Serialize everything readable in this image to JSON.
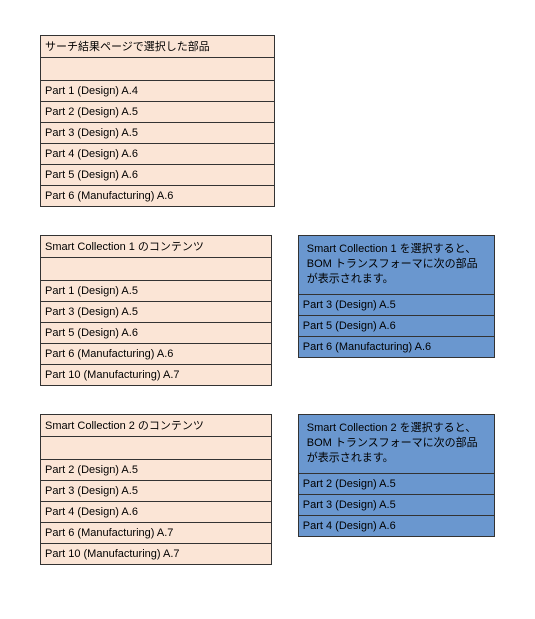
{
  "search": {
    "header": "サーチ結果ページで選択した部品",
    "rows": [
      "Part 1 (Design) A.4",
      "Part 2 (Design) A.5",
      "Part 3 (Design) A.5",
      "Part 4 (Design) A.6",
      "Part 5 (Design) A.6",
      "Part 6 (Manufacturing) A.6"
    ]
  },
  "sc1": {
    "header": "Smart Collection 1 のコンテンツ",
    "rows": [
      "Part 1 (Design) A.5",
      "Part 3 (Design) A.5",
      "Part 5 (Design) A.6",
      "Part 6 (Manufacturing) A.6",
      "Part 10 (Manufacturing) A.7"
    ],
    "msg": "Smart Collection 1 を選択すると、BOM トランスフォーマに次の部品が表示されます。",
    "result": [
      "Part 3 (Design) A.5",
      "Part 5 (Design) A.6",
      "Part 6 (Manufacturing) A.6"
    ]
  },
  "sc2": {
    "header": "Smart Collection 2 のコンテンツ",
    "rows": [
      "Part 2 (Design) A.5",
      "Part 3 (Design) A.5",
      "Part 4 (Design) A.6",
      "Part 6 (Manufacturing) A.7",
      "Part 10 (Manufacturing) A.7"
    ],
    "msg": "Smart Collection 2 を選択すると、BOM トランスフォーマに次の部品が表示されます。",
    "result": [
      "Part 2 (Design) A.5",
      "Part 3 (Design) A.5",
      "Part 4 (Design) A.6"
    ]
  }
}
